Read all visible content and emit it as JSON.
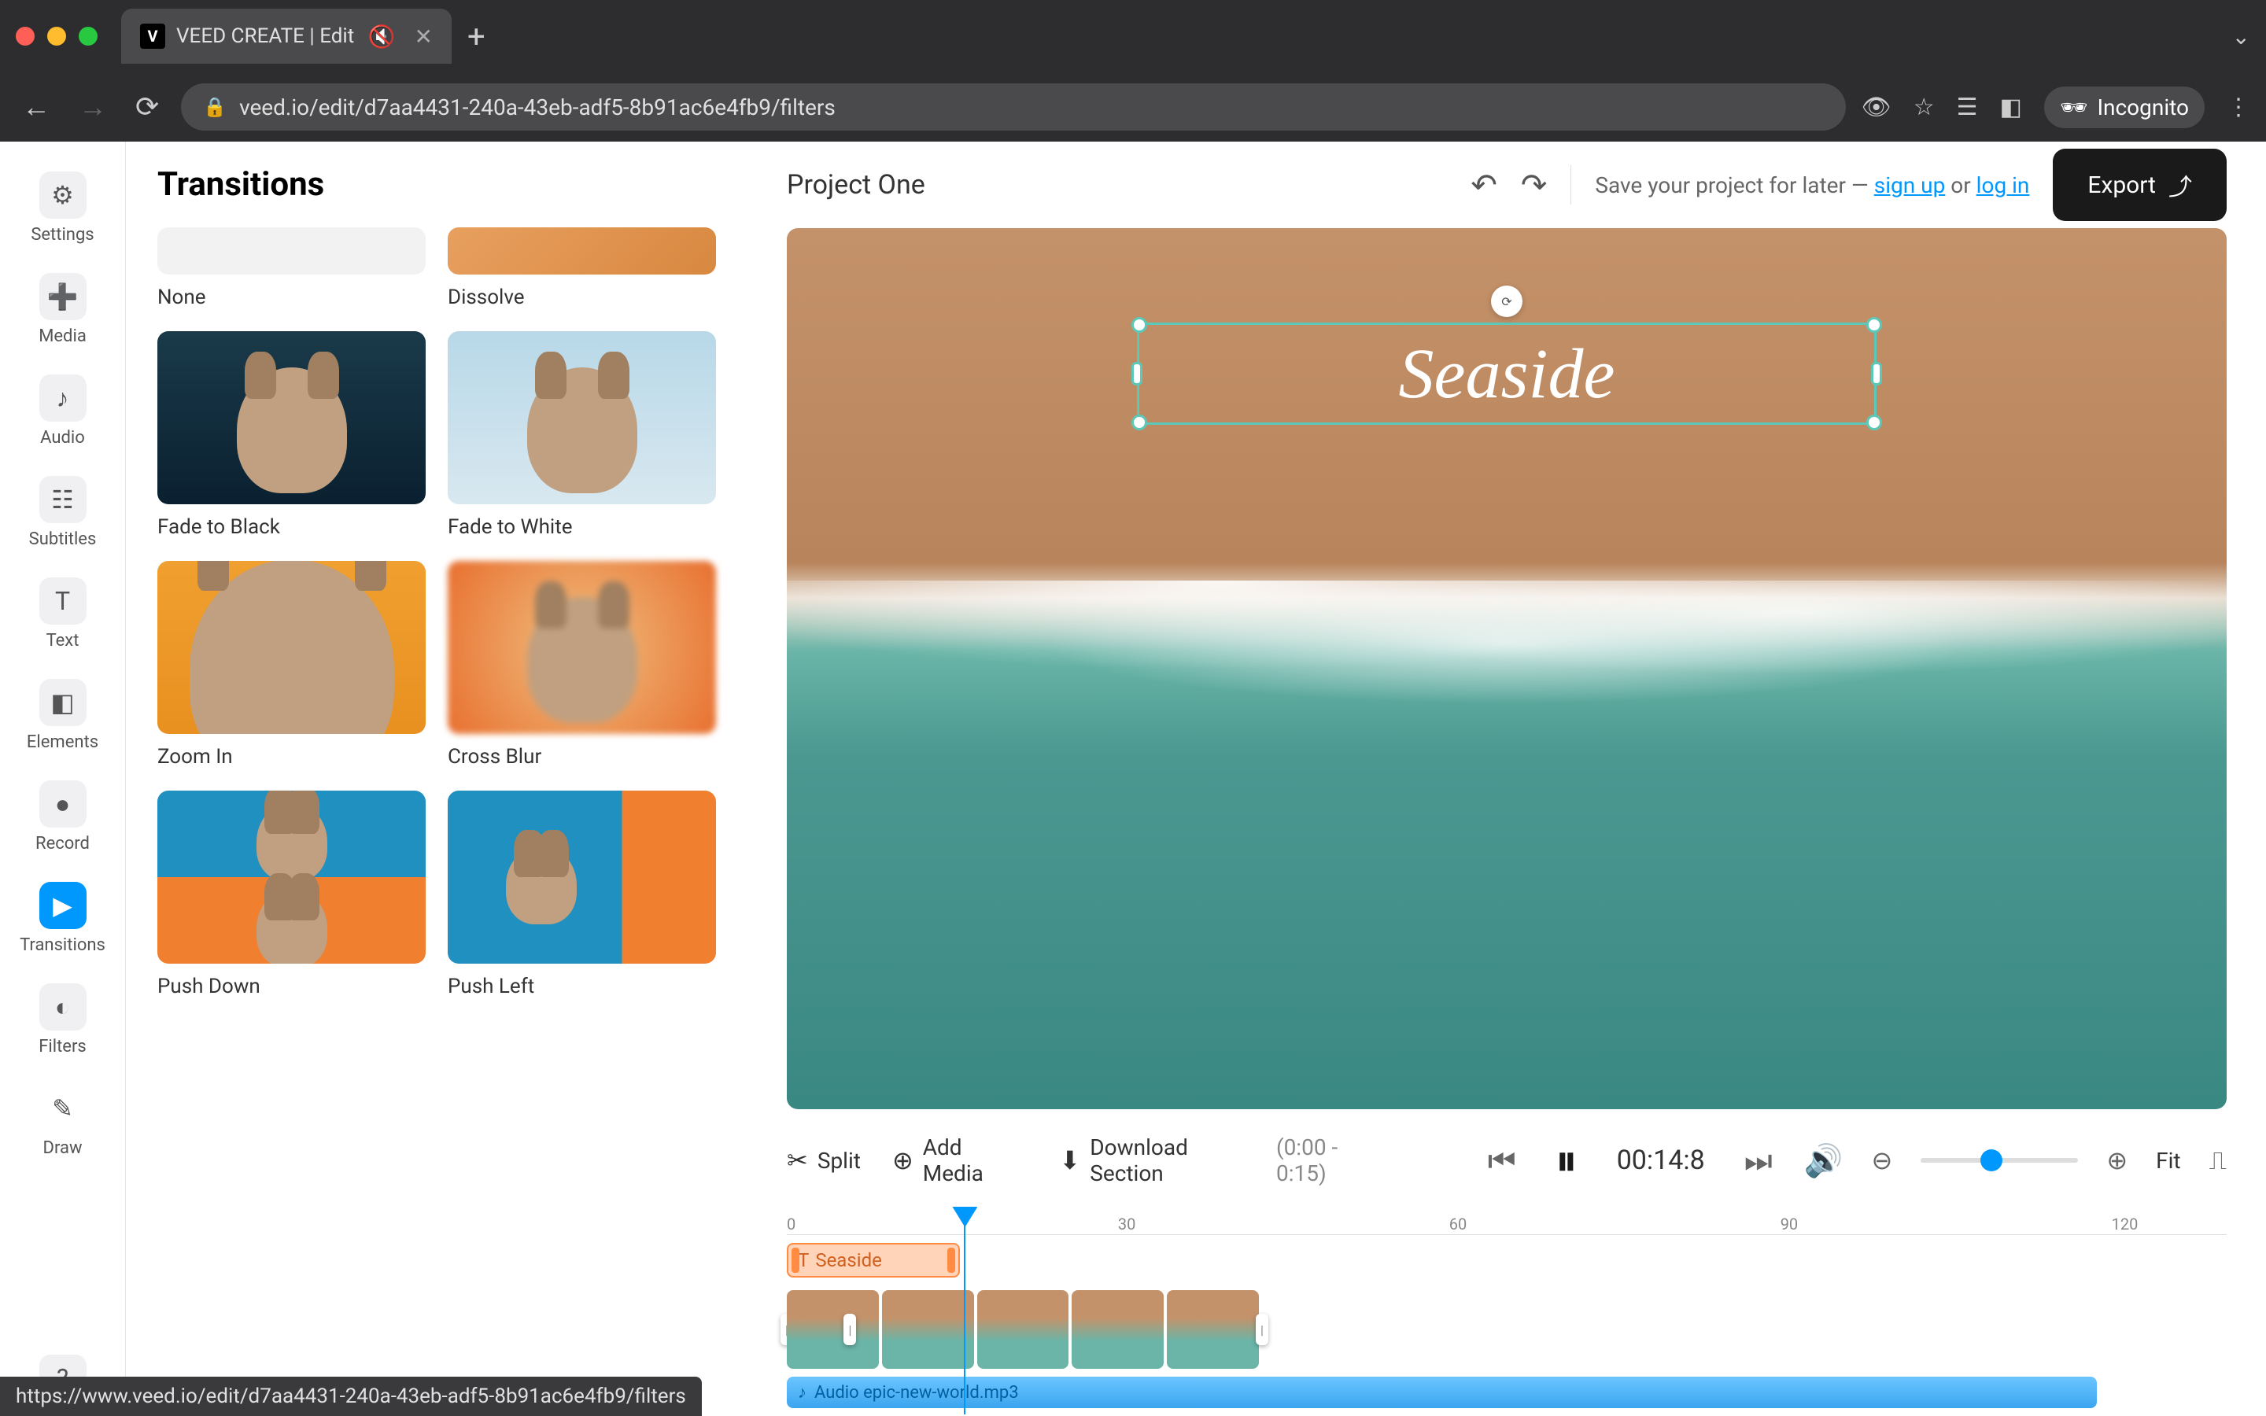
{
  "browser": {
    "tab_title": "VEED CREATE | Edit",
    "url": "veed.io/edit/d7aa4431-240a-43eb-adf5-8b91ac6e4fb9/filters",
    "incognito_label": "Incognito"
  },
  "sidebar": {
    "items": [
      {
        "label": "Settings",
        "icon": "⚙"
      },
      {
        "label": "Media",
        "icon": "➕"
      },
      {
        "label": "Audio",
        "icon": "♪"
      },
      {
        "label": "Subtitles",
        "icon": "☷"
      },
      {
        "label": "Text",
        "icon": "T"
      },
      {
        "label": "Elements",
        "icon": "◧"
      },
      {
        "label": "Record",
        "icon": "●"
      },
      {
        "label": "Transitions",
        "icon": "▶"
      },
      {
        "label": "Filters",
        "icon": "◐"
      },
      {
        "label": "Draw",
        "icon": "✎"
      }
    ],
    "help_icon": "?"
  },
  "panel": {
    "title": "Transitions",
    "items": [
      {
        "label": "None"
      },
      {
        "label": "Dissolve"
      },
      {
        "label": "Fade to Black"
      },
      {
        "label": "Fade to White"
      },
      {
        "label": "Zoom In"
      },
      {
        "label": "Cross Blur"
      },
      {
        "label": "Push Down"
      },
      {
        "label": "Push Left"
      }
    ]
  },
  "header": {
    "project_name": "Project One",
    "save_prefix": "Save your project for later — ",
    "signup": "sign up",
    "or": " or ",
    "login": "log in",
    "export": "Export"
  },
  "canvas": {
    "text_overlay": "Seaside"
  },
  "toolbar": {
    "split": "Split",
    "add_media": "Add Media",
    "download_section": "Download Section",
    "download_range": "(0:00 - 0:15)",
    "timecode": "00:14:8",
    "fit": "Fit"
  },
  "timeline": {
    "ruler_marks": [
      "0",
      "30",
      "60",
      "90",
      "120"
    ],
    "text_clip_label": "Seaside",
    "audio_clip_label": "Audio epic-new-world.mp3"
  },
  "status_bar": "https://www.veed.io/edit/d7aa4431-240a-43eb-adf5-8b91ac6e4fb9/filters"
}
